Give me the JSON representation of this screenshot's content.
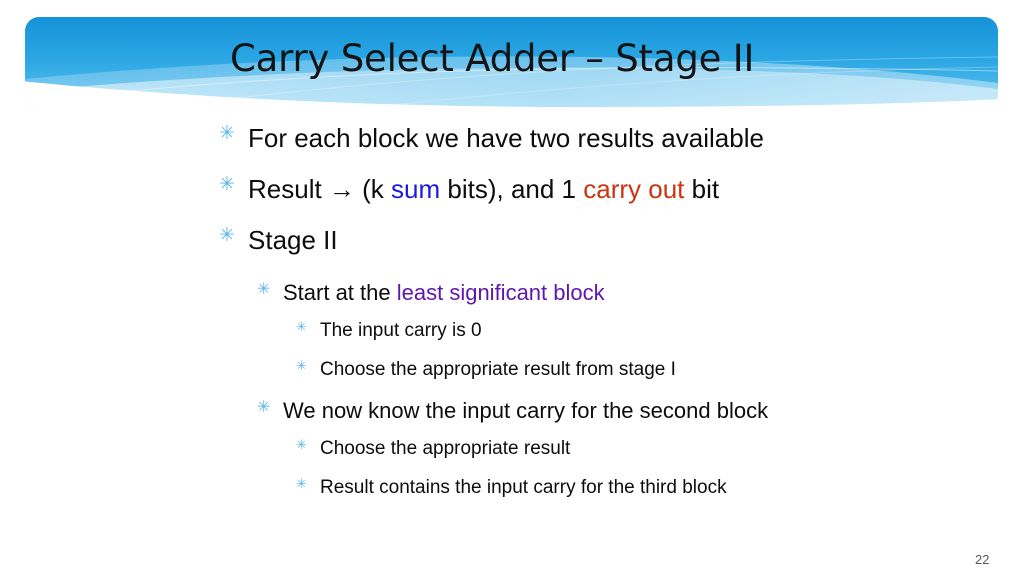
{
  "slide": {
    "title": "Carry Select Adder – Stage II",
    "number": "22",
    "bullet_glyph": "✳",
    "colors": {
      "banner_top": "#1b9ede",
      "banner_light": "#8ed3f2",
      "bullet_marker": "#5bb5e8",
      "body_text": "#0d0d0d",
      "title_text": "#141414",
      "emphasis_blue": "#1a1ae0",
      "emphasis_red": "#cc3311",
      "emphasis_purple": "#5f16b0",
      "slide_number": "#5a5a5a",
      "background": "#ffffff"
    }
  },
  "content": {
    "b1": {
      "text": "For each block we have two results available"
    },
    "b2": {
      "pre": "Result → (k ",
      "blue": "sum",
      "mid": " bits), and 1 ",
      "red": "carry out",
      "post": " bit"
    },
    "b3": {
      "text": "Stage II"
    },
    "b4": {
      "pre": "Start at the ",
      "purple": "least significant block"
    },
    "b5": {
      "text": "The input carry is 0"
    },
    "b6": {
      "text": "Choose the appropriate result from stage I"
    },
    "b7": {
      "text": "We now know the input carry for the second block"
    },
    "b8": {
      "text": "Choose the appropriate result"
    },
    "b9": {
      "text": "Result contains the input carry for the third block"
    }
  }
}
